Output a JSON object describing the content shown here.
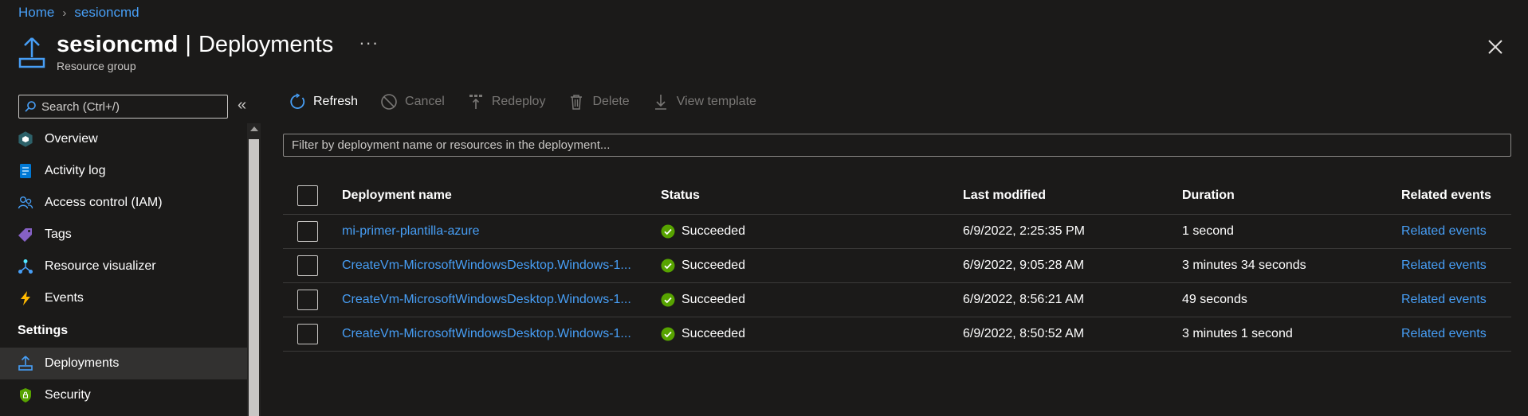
{
  "breadcrumb": {
    "home": "Home",
    "current": "sesioncmd"
  },
  "header": {
    "resource_name": "sesioncmd",
    "separator": "|",
    "page": "Deployments",
    "more": "···",
    "subtitle": "Resource group"
  },
  "sidebar": {
    "search_placeholder": "Search (Ctrl+/)",
    "collapse": "«",
    "items": [
      {
        "label": "Overview",
        "icon": "overview-icon"
      },
      {
        "label": "Activity log",
        "icon": "activity-log-icon"
      },
      {
        "label": "Access control (IAM)",
        "icon": "iam-icon"
      },
      {
        "label": "Tags",
        "icon": "tag-icon"
      },
      {
        "label": "Resource visualizer",
        "icon": "visualizer-icon"
      },
      {
        "label": "Events",
        "icon": "lightning-icon"
      }
    ],
    "section": "Settings",
    "settings_items": [
      {
        "label": "Deployments",
        "icon": "deployments-icon",
        "active": true
      },
      {
        "label": "Security",
        "icon": "shield-icon"
      }
    ]
  },
  "toolbar": {
    "refresh": "Refresh",
    "cancel": "Cancel",
    "redeploy": "Redeploy",
    "delete": "Delete",
    "view_template": "View template"
  },
  "filter": {
    "placeholder": "Filter by deployment name or resources in the deployment..."
  },
  "table": {
    "columns": [
      "Deployment name",
      "Status",
      "Last modified",
      "Duration",
      "Related events"
    ],
    "rows": [
      {
        "name": "mi-primer-plantilla-azure",
        "status": "Succeeded",
        "modified": "6/9/2022, 2:25:35 PM",
        "duration": "1 second",
        "events": "Related events"
      },
      {
        "name": "CreateVm-MicrosoftWindowsDesktop.Windows-1...",
        "status": "Succeeded",
        "modified": "6/9/2022, 9:05:28 AM",
        "duration": "3 minutes 34 seconds",
        "events": "Related events"
      },
      {
        "name": "CreateVm-MicrosoftWindowsDesktop.Windows-1...",
        "status": "Succeeded",
        "modified": "6/9/2022, 8:56:21 AM",
        "duration": "49 seconds",
        "events": "Related events"
      },
      {
        "name": "CreateVm-MicrosoftWindowsDesktop.Windows-1...",
        "status": "Succeeded",
        "modified": "6/9/2022, 8:50:52 AM",
        "duration": "3 minutes 1 second",
        "events": "Related events"
      }
    ]
  },
  "colors": {
    "accent": "#479ef5",
    "success": "#57a300",
    "background": "#1b1a19"
  }
}
